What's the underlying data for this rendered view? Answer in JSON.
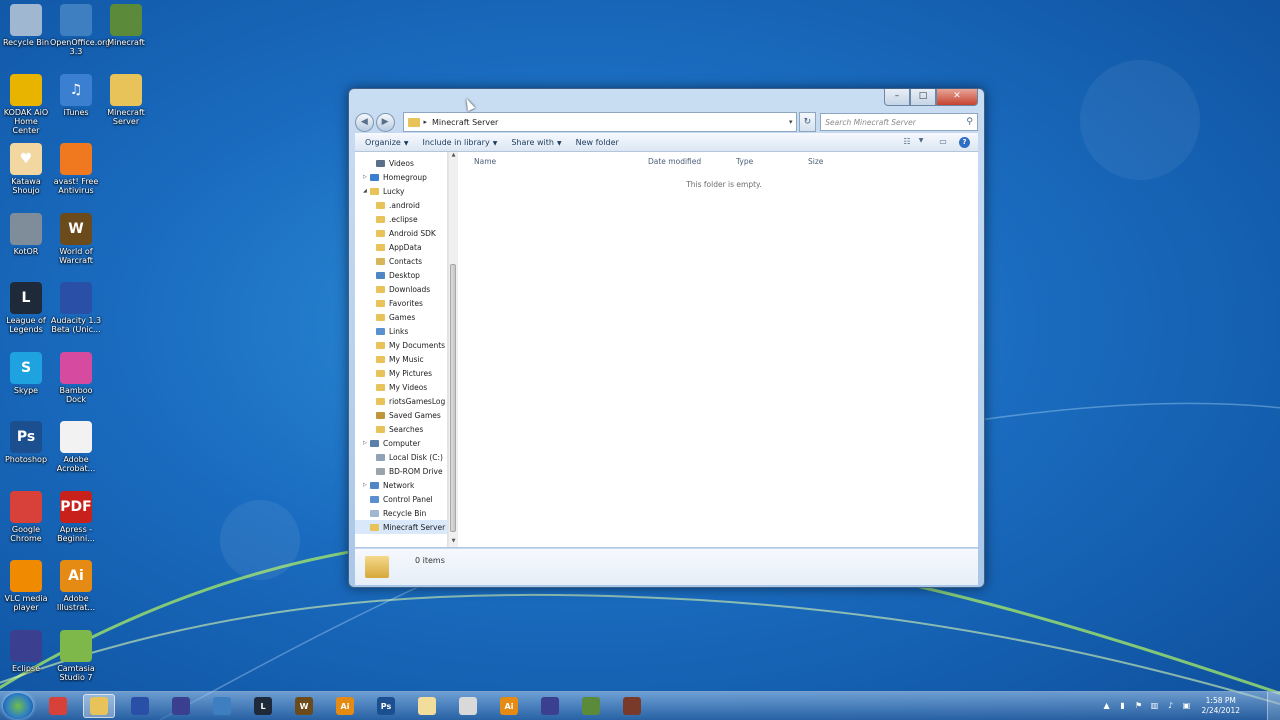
{
  "desktop": {
    "icons": [
      {
        "label": "Recycle Bin",
        "icon": "recycle-bin-icon",
        "color": "#9fb7d0",
        "glyph": ""
      },
      {
        "label": "OpenOffice.org 3.3",
        "icon": "openoffice-icon",
        "color": "#3d7fc1",
        "glyph": ""
      },
      {
        "label": "Minecraft",
        "icon": "minecraft-icon",
        "color": "#5b8a3a",
        "glyph": ""
      },
      {
        "label": "KODAK AiO Home Center",
        "icon": "kodak-icon",
        "color": "#e8b400",
        "glyph": ""
      },
      {
        "label": "iTunes",
        "icon": "itunes-icon",
        "color": "#3a7fd0",
        "glyph": "♫"
      },
      {
        "label": "Minecraft Server",
        "icon": "folder-icon",
        "color": "#e8c35a",
        "glyph": ""
      },
      {
        "label": "Katawa Shoujo",
        "icon": "heart-icon",
        "color": "#f2d7a0",
        "glyph": "♥"
      },
      {
        "label": "avast! Free Antivirus",
        "icon": "avast-icon",
        "color": "#f0781e",
        "glyph": ""
      },
      {
        "label": "KotOR",
        "icon": "kotor-icon",
        "color": "#7f8c99",
        "glyph": ""
      },
      {
        "label": "World of Warcraft",
        "icon": "wow-icon",
        "color": "#6b4a1c",
        "glyph": "W"
      },
      {
        "label": "League of Legends",
        "icon": "lol-icon",
        "color": "#1e2a3a",
        "glyph": "L"
      },
      {
        "label": "Audacity 1.3 Beta (Unic...",
        "icon": "audacity-icon",
        "color": "#2a4fa6",
        "glyph": ""
      },
      {
        "label": "Skype",
        "icon": "skype-icon",
        "color": "#1fa3e0",
        "glyph": "S"
      },
      {
        "label": "Bamboo Dock",
        "icon": "bamboo-icon",
        "color": "#d64aa0",
        "glyph": ""
      },
      {
        "label": "Photoshop",
        "icon": "photoshop-icon",
        "color": "#1c4f8f",
        "glyph": "Ps"
      },
      {
        "label": "Adobe Acrobat...",
        "icon": "acrobat-icon",
        "color": "#f2f2f2",
        "glyph": ""
      },
      {
        "label": "Google Chrome",
        "icon": "chrome-icon",
        "color": "#d8413a",
        "glyph": ""
      },
      {
        "label": "Apress - Beginni...",
        "icon": "pdf-icon",
        "color": "#c8201b",
        "glyph": "PDF"
      },
      {
        "label": "VLC media player",
        "icon": "vlc-icon",
        "color": "#f08a00",
        "glyph": ""
      },
      {
        "label": "Adobe Illustrat...",
        "icon": "illustrator-icon",
        "color": "#e58a12",
        "glyph": "Ai"
      },
      {
        "label": "Eclipse",
        "icon": "eclipse-icon",
        "color": "#3b3f8f",
        "glyph": ""
      },
      {
        "label": "Camtasia Studio 7",
        "icon": "camtasia-icon",
        "color": "#7fb84a",
        "glyph": ""
      }
    ]
  },
  "window": {
    "breadcrumb": "Minecraft Server",
    "search_placeholder": "Search Minecraft Server",
    "toolbar": {
      "organize": "Organize",
      "include_in_library": "Include in library",
      "share_with": "Share with",
      "new_folder": "New folder"
    },
    "columns": {
      "name": "Name",
      "date_modified": "Date modified",
      "type": "Type",
      "size": "Size"
    },
    "empty_message": "This folder is empty.",
    "item_count": "0 items",
    "nav_items": [
      {
        "label": "Videos",
        "icon": "videos-library-icon",
        "color": "#5a6f8a",
        "indent": 1,
        "expander": ""
      },
      {
        "label": "Homegroup",
        "icon": "homegroup-icon",
        "color": "#3a7fd0",
        "indent": 0,
        "expander": "▷"
      },
      {
        "label": "Lucky",
        "icon": "user-folder-icon",
        "color": "#e8c35a",
        "indent": 0,
        "expander": "◢"
      },
      {
        "label": ".android",
        "icon": "folder-icon",
        "color": "#e8c35a",
        "indent": 1,
        "expander": ""
      },
      {
        "label": ".eclipse",
        "icon": "folder-icon",
        "color": "#e8c35a",
        "indent": 1,
        "expander": ""
      },
      {
        "label": "Android SDK",
        "icon": "folder-icon",
        "color": "#e8c35a",
        "indent": 1,
        "expander": ""
      },
      {
        "label": "AppData",
        "icon": "folder-icon",
        "color": "#e8c35a",
        "indent": 1,
        "expander": ""
      },
      {
        "label": "Contacts",
        "icon": "contacts-folder-icon",
        "color": "#d9b55a",
        "indent": 1,
        "expander": ""
      },
      {
        "label": "Desktop",
        "icon": "desktop-folder-icon",
        "color": "#4f86c6",
        "indent": 1,
        "expander": ""
      },
      {
        "label": "Downloads",
        "icon": "downloads-folder-icon",
        "color": "#e8c35a",
        "indent": 1,
        "expander": ""
      },
      {
        "label": "Favorites",
        "icon": "favorites-folder-icon",
        "color": "#e8c35a",
        "indent": 1,
        "expander": ""
      },
      {
        "label": "Games",
        "icon": "games-folder-icon",
        "color": "#e8c35a",
        "indent": 1,
        "expander": ""
      },
      {
        "label": "Links",
        "icon": "links-folder-icon",
        "color": "#5a8fd0",
        "indent": 1,
        "expander": ""
      },
      {
        "label": "My Documents",
        "icon": "documents-folder-icon",
        "color": "#e8c35a",
        "indent": 1,
        "expander": ""
      },
      {
        "label": "My Music",
        "icon": "music-folder-icon",
        "color": "#e8c35a",
        "indent": 1,
        "expander": ""
      },
      {
        "label": "My Pictures",
        "icon": "pictures-folder-icon",
        "color": "#e8c35a",
        "indent": 1,
        "expander": ""
      },
      {
        "label": "My Videos",
        "icon": "videos-folder-icon",
        "color": "#e8c35a",
        "indent": 1,
        "expander": ""
      },
      {
        "label": "riotsGamesLog",
        "icon": "folder-icon",
        "color": "#e8c35a",
        "indent": 1,
        "expander": ""
      },
      {
        "label": "Saved Games",
        "icon": "saved-games-folder-icon",
        "color": "#c0963a",
        "indent": 1,
        "expander": ""
      },
      {
        "label": "Searches",
        "icon": "searches-folder-icon",
        "color": "#e8c35a",
        "indent": 1,
        "expander": ""
      },
      {
        "label": "Computer",
        "icon": "computer-icon",
        "color": "#5a7fa8",
        "indent": 0,
        "expander": "▷"
      },
      {
        "label": "Local Disk (C:)",
        "icon": "local-disk-icon",
        "color": "#8fa2b6",
        "indent": 1,
        "expander": ""
      },
      {
        "label": "BD-ROM Drive",
        "icon": "bd-rom-icon",
        "color": "#9aa4ad",
        "indent": 1,
        "expander": ""
      },
      {
        "label": "Network",
        "icon": "network-icon",
        "color": "#4f86c6",
        "indent": 0,
        "expander": "▷"
      },
      {
        "label": "Control Panel",
        "icon": "control-panel-icon",
        "color": "#5a8fd0",
        "indent": 0,
        "expander": ""
      },
      {
        "label": "Recycle Bin",
        "icon": "recycle-bin-icon",
        "color": "#9fb7d0",
        "indent": 0,
        "expander": ""
      },
      {
        "label": "Minecraft Server",
        "icon": "folder-icon",
        "color": "#e8c35a",
        "indent": 0,
        "expander": "",
        "selected": true
      }
    ]
  },
  "taskbar": {
    "apps": [
      {
        "icon": "chrome-icon",
        "color": "#d8413a",
        "glyph": ""
      },
      {
        "icon": "explorer-icon",
        "color": "#e8c35a",
        "glyph": "",
        "active": true
      },
      {
        "icon": "audacity-icon",
        "color": "#2a4fa6",
        "glyph": ""
      },
      {
        "icon": "eclipse-icon",
        "color": "#3b3f8f",
        "glyph": ""
      },
      {
        "icon": "openoffice-icon",
        "color": "#3d7fc1",
        "glyph": ""
      },
      {
        "icon": "lol-icon",
        "color": "#1e2a3a",
        "glyph": "L"
      },
      {
        "icon": "wow-icon",
        "color": "#6b4a1c",
        "glyph": "W"
      },
      {
        "icon": "illustrator-icon",
        "color": "#e58a12",
        "glyph": "Ai"
      },
      {
        "icon": "photoshop-icon",
        "color": "#1c4f8f",
        "glyph": "Ps"
      },
      {
        "icon": "folder-icon",
        "color": "#f2de9a",
        "glyph": ""
      },
      {
        "icon": "acrobat-icon",
        "color": "#d9d9d9",
        "glyph": ""
      },
      {
        "icon": "illustrator-icon",
        "color": "#e58a12",
        "glyph": "Ai"
      },
      {
        "icon": "eclipse-icon",
        "color": "#3b3f8f",
        "glyph": ""
      },
      {
        "icon": "minecraft-icon",
        "color": "#5b8a3a",
        "glyph": ""
      },
      {
        "icon": "minecraft-server-icon",
        "color": "#7a3a2a",
        "glyph": ""
      }
    ],
    "time": "1:58 PM",
    "date": "2/24/2012"
  }
}
